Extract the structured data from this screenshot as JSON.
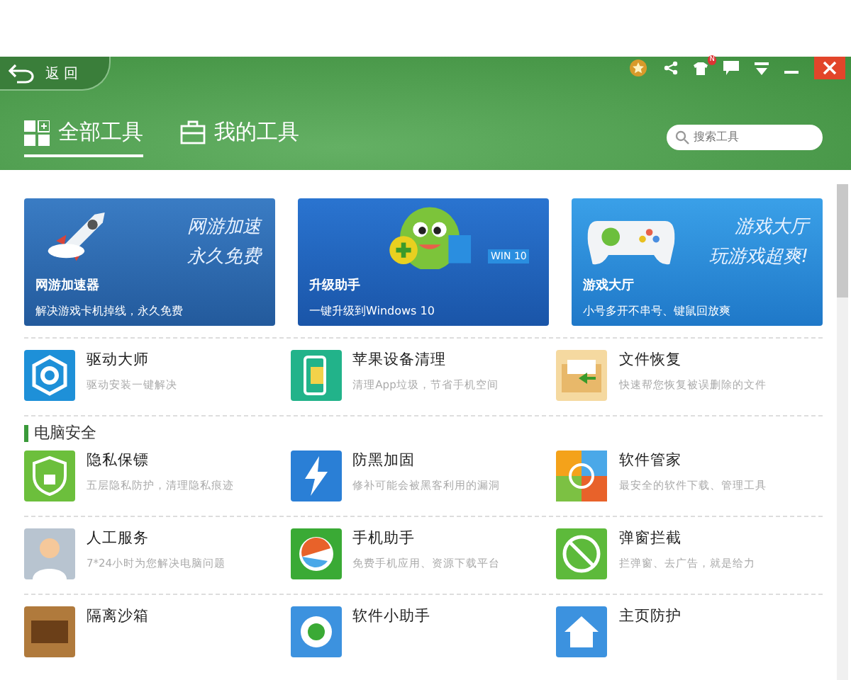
{
  "header": {
    "back_label": "返 回",
    "tabs": [
      {
        "label": "全部工具",
        "kind": "grid",
        "selected": true
      },
      {
        "label": "我的工具",
        "kind": "case",
        "selected": false
      }
    ],
    "search": {
      "placeholder": "搜索工具"
    },
    "notification_badge": "N"
  },
  "banners": [
    {
      "kind": "rocket",
      "headline": [
        "网游加速",
        "永久免费"
      ],
      "title": "网游加速器",
      "subtitle": "解决游戏卡机掉线，永久免费"
    },
    {
      "kind": "robot",
      "art_label": "WIN 10",
      "title": "升级助手",
      "subtitle": "一键升级到Windows 10"
    },
    {
      "kind": "gamepad",
      "headline": [
        "游戏大厅",
        "玩游戏超爽!"
      ],
      "title": "游戏大厅",
      "subtitle": "小号多开不串号、键鼠回放爽"
    }
  ],
  "sections": [
    {
      "rows": [
        [
          {
            "kind": "gear",
            "name": "驱动大师",
            "desc": "驱动安装一键解决"
          },
          {
            "kind": "phone",
            "name": "苹果设备清理",
            "desc": "清理App垃圾，节省手机空间"
          },
          {
            "kind": "folder",
            "name": "文件恢复",
            "desc": "快速帮您恢复被误删除的文件"
          }
        ]
      ]
    },
    {
      "heading": "电脑安全",
      "rows": [
        [
          {
            "kind": "shield",
            "name": "隐私保镖",
            "desc": "五层隐私防护，清理隐私痕迹"
          },
          {
            "kind": "bolt",
            "name": "防黑加固",
            "desc": "修补可能会被黑客利用的漏洞"
          },
          {
            "kind": "flower",
            "name": "软件管家",
            "desc": "最安全的软件下载、管理工具"
          }
        ],
        [
          {
            "kind": "person",
            "name": "人工服务",
            "desc": "7*24小时为您解决电脑问题"
          },
          {
            "kind": "ball",
            "name": "手机助手",
            "desc": "免费手机应用、资源下载平台"
          },
          {
            "kind": "block",
            "name": "弹窗拦截",
            "desc": "拦弹窗、去广告，就是给力"
          }
        ],
        [
          {
            "kind": "sandbox",
            "name": "隔离沙箱"
          },
          {
            "kind": "helper",
            "name": "软件小助手"
          },
          {
            "kind": "home",
            "name": "主页防护"
          }
        ]
      ]
    }
  ]
}
